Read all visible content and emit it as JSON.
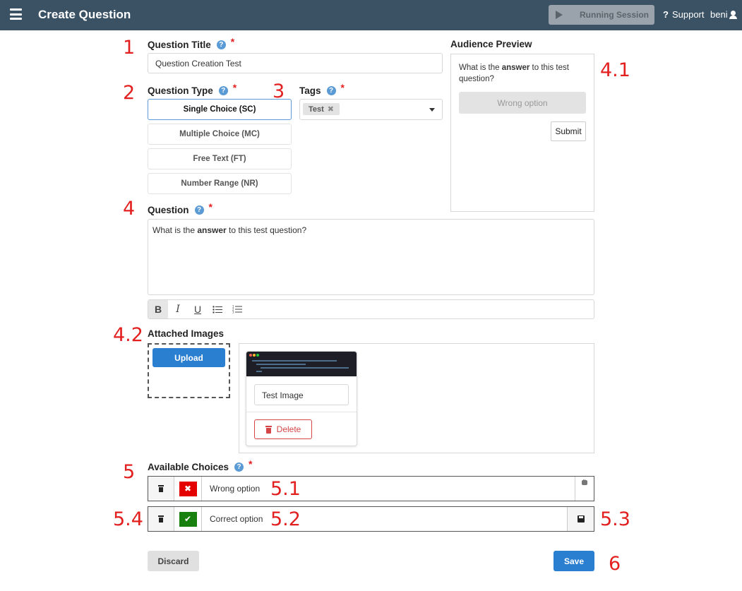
{
  "header": {
    "title": "Create Question",
    "running_session_label": "Running Session",
    "support_label": "Support",
    "user_name": "beni"
  },
  "annotations": {
    "n1": "1",
    "n2": "2",
    "n3": "3",
    "n4": "4",
    "n4_1": "4.1",
    "n4_2": "4.2",
    "n5": "5",
    "n5_1": "5.1",
    "n5_2": "5.2",
    "n5_3": "5.3",
    "n5_4": "5.4",
    "n6": "6"
  },
  "form": {
    "title_label": "Question Title",
    "title_value": "Question Creation Test",
    "type_label": "Question Type",
    "types": [
      "Single Choice (SC)",
      "Multiple Choice (MC)",
      "Free Text (FT)",
      "Number Range (NR)"
    ],
    "selected_type": "Single Choice (SC)",
    "tags_label": "Tags",
    "tags": [
      "Test"
    ],
    "question_label": "Question",
    "question_pre": "What is the ",
    "question_bold": "answer",
    "question_post": " to this test question?",
    "images_label": "Attached Images",
    "upload_label": "Upload",
    "image_name": "Test Image",
    "delete_label": "Delete",
    "choices_label": "Available Choices",
    "choices": [
      {
        "text": "Wrong option",
        "correct": false
      },
      {
        "text": "Correct option",
        "correct": true
      }
    ],
    "discard_label": "Discard",
    "save_label": "Save"
  },
  "preview": {
    "heading": "Audience Preview",
    "question_pre": "What is the ",
    "question_bold": "answer",
    "question_post": " to this test question?",
    "option": "Wrong option",
    "submit_label": "Submit"
  },
  "toolbar": {
    "bold": "B",
    "italic": "I",
    "underline": "U"
  },
  "colors": {
    "header_bg": "#3b5265",
    "primary": "#2b7fd1",
    "annotation_red": "#e32020",
    "wrong_mark": "#e50000",
    "correct_mark": "#17800e"
  }
}
